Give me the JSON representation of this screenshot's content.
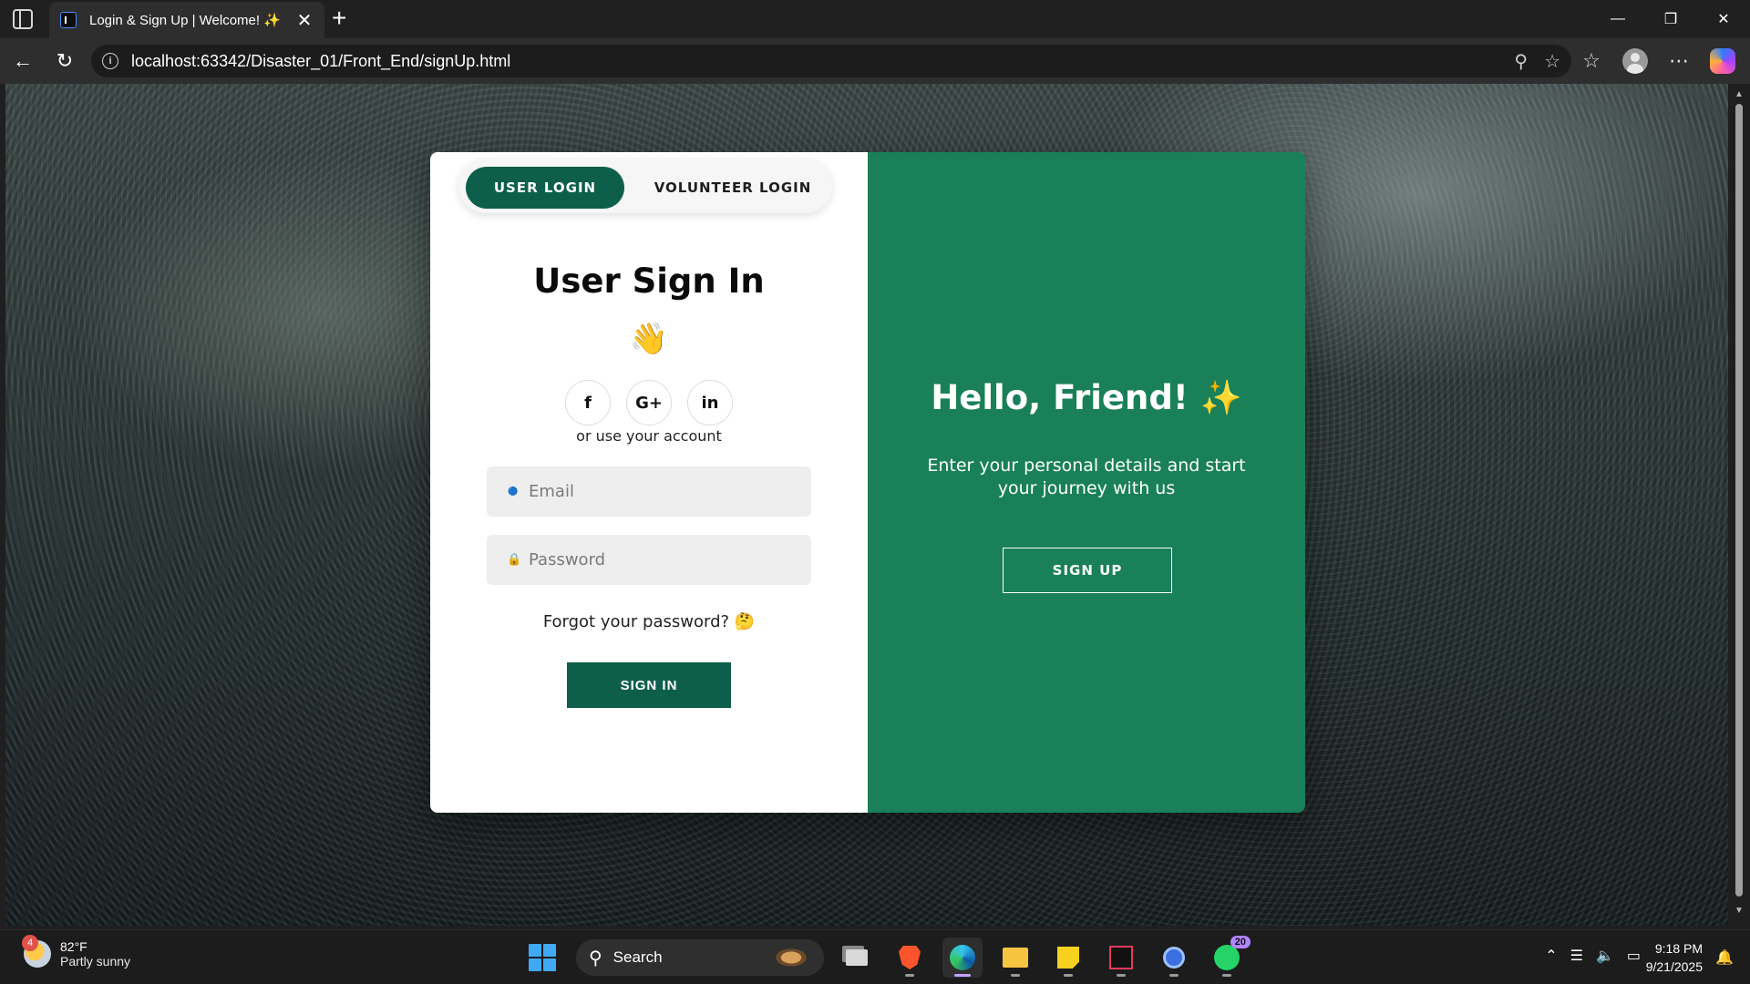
{
  "browser": {
    "tab_title": "Login & Sign Up | Welcome! ✨",
    "tab_close": "✕",
    "new_tab": "+",
    "url": "localhost:63342/Disaster_01/Front_End/signUp.html",
    "icons": [
      "tab-actions-icon",
      "back-icon",
      "refresh-icon",
      "info-icon",
      "key-icon",
      "star-icon",
      "favorites-icon",
      "profile-icon",
      "more-icon",
      "copilot-icon"
    ],
    "minimize": "—",
    "restore": "❐",
    "close": "✕"
  },
  "tabs": {
    "user_login": "USER LOGIN",
    "volunteer_login": "VOLUNTEER LOGIN"
  },
  "signin": {
    "title": "User Sign In",
    "wave_emoji": "👋",
    "socials": [
      {
        "name": "facebook",
        "glyph": "f"
      },
      {
        "name": "google",
        "glyph": "G+"
      },
      {
        "name": "linkedin",
        "glyph": "in"
      }
    ],
    "or_text": "or use your account",
    "email_placeholder": "Email",
    "email_icon": "🔵",
    "password_placeholder": "Password",
    "password_icon": "🔒",
    "forgot": "Forgot your password? 🤔",
    "button": "SIGN IN"
  },
  "panel": {
    "title": "Hello, Friend! ✨",
    "description": "Enter your personal details and start your journey with us",
    "button": "SIGN UP",
    "background_color": "#198059"
  },
  "taskbar": {
    "weather_badge": "4",
    "weather_temp": "82°F",
    "weather_condition": "Partly sunny",
    "search_label": "Search",
    "whatsapp_badge": "20",
    "time": "9:18 PM",
    "date": "9/21/2025",
    "apps": [
      "task-view-icon",
      "brave-icon",
      "edge-icon",
      "file-explorer-icon",
      "sticky-notes-icon",
      "intellij-icon",
      "copilot-app-icon",
      "whatsapp-icon"
    ]
  }
}
